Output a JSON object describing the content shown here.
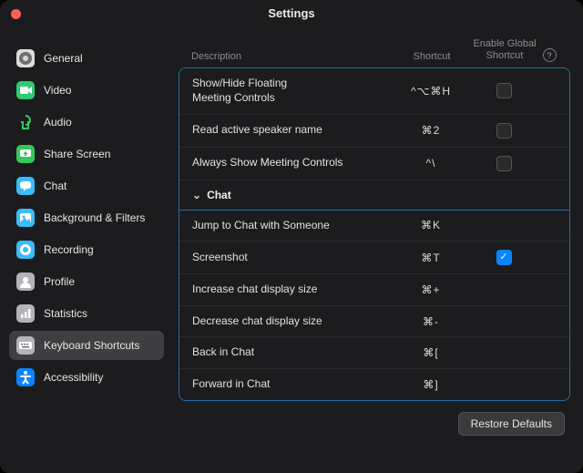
{
  "window": {
    "title": "Settings"
  },
  "sidebar": {
    "items": [
      {
        "id": "general",
        "label": "General",
        "color": "#dcdcdc",
        "icon": "<circle cx='10' cy='10' r='7' fill='#6e6e6e'/><circle cx='10' cy='10' r='3' fill='#d8d8d8'/>"
      },
      {
        "id": "video",
        "label": "Video",
        "color": "#2ecc71",
        "icon": "<rect x='4' y='6' width='9' height='8' rx='1.5' fill='#fff'/><path d='M13 9 L17 6 V14 L13 11 Z' fill='#fff'/>"
      },
      {
        "id": "audio",
        "label": "Audio",
        "color": "none",
        "icon": "<path d='M10 3 A5 5 0 0 1 10 13' fill='none' stroke='#34c759' stroke-width='2'/><path d='M5 10 h2 v7 h6 v-7 h2' fill='none' stroke='#34c759' stroke-width='2'/>"
      },
      {
        "id": "share",
        "label": "Share Screen",
        "color": "#34c759",
        "icon": "<rect x='4' y='5' width='12' height='8' rx='1.5' fill='#fff'/><path d='M10 7 L7 10 H9 V12 H11 V10 H13 Z' fill='#34c759'/>"
      },
      {
        "id": "chat",
        "label": "Chat",
        "color": "#38bdf8",
        "icon": "<rect x='4' y='5' width='12' height='8' rx='3' fill='#fff'/><path d='M8 13 L8 16 L11 13 Z' fill='#fff'/>"
      },
      {
        "id": "bg",
        "label": "Background & Filters",
        "color": "#38bdf8",
        "icon": "<rect x='4' y='5' width='12' height='10' rx='2' fill='#fff'/><circle cx='8' cy='9' r='1.5' fill='#38bdf8'/><path d='M5 14 L9 10 L12 13 L15 11 V15 H5 Z' fill='#38bdf8'/>"
      },
      {
        "id": "rec",
        "label": "Recording",
        "color": "#38bdf8",
        "icon": "<circle cx='10' cy='10' r='6' fill='#fff'/><circle cx='10' cy='10' r='3' fill='#38bdf8'/>"
      },
      {
        "id": "profile",
        "label": "Profile",
        "color": "#b4b4b8",
        "icon": "<circle cx='10' cy='8' r='3' fill='#fff'/><path d='M4 17 a6 6 0 0 1 12 0 Z' fill='#fff'/>"
      },
      {
        "id": "stats",
        "label": "Statistics",
        "color": "#b4b4b8",
        "icon": "<rect x='5' y='11' width='2.5' height='4' fill='#fff'/><rect x='9' y='8' width='2.5' height='7' fill='#fff'/><rect x='13' y='5' width='2.5' height='10' fill='#fff'/>"
      },
      {
        "id": "kbd",
        "label": "Keyboard Shortcuts",
        "color": "#b4b4b8",
        "icon": "<rect x='3' y='6' width='14' height='8' rx='1.5' fill='#fff'/><rect x='5' y='8' width='2' height='1.5' fill='#6e6e6e'/><rect x='8' y='8' width='2' height='1.5' fill='#6e6e6e'/><rect x='11' y='8' width='2' height='1.5' fill='#6e6e6e'/><rect x='6' y='11' width='8' height='1.5' fill='#6e6e6e'/>"
      },
      {
        "id": "a11y",
        "label": "Accessibility",
        "color": "#0a84ff",
        "icon": "<circle cx='10' cy='5' r='2' fill='#fff'/><rect x='4' y='8' width='12' height='2' rx='1' fill='#fff'/><path d='M10 9 V13 L7 17 M10 13 L13 17' stroke='#fff' stroke-width='2' fill='none'/>"
      }
    ],
    "active": "kbd"
  },
  "columns": {
    "desc": "Description",
    "shortcut": "Shortcut",
    "global": "Enable Global Shortcut"
  },
  "rows": [
    {
      "type": "item",
      "desc": "Show/Hide Floating\nMeeting Controls",
      "shortcut": "^⌥⌘H",
      "global": "off"
    },
    {
      "type": "item",
      "desc": "Read active speaker name",
      "shortcut": "⌘2",
      "global": "off"
    },
    {
      "type": "item",
      "desc": "Always Show Meeting Controls",
      "shortcut": "^\\",
      "global": "off"
    },
    {
      "type": "section",
      "desc": "Chat"
    },
    {
      "type": "item",
      "desc": "Jump to Chat with Someone",
      "shortcut": "⌘K",
      "global": "none"
    },
    {
      "type": "item",
      "desc": "Screenshot",
      "shortcut": "⌘T",
      "global": "on"
    },
    {
      "type": "item",
      "desc": "Increase chat display size",
      "shortcut": "⌘+",
      "global": "none"
    },
    {
      "type": "item",
      "desc": "Decrease chat display size",
      "shortcut": "⌘-",
      "global": "none"
    },
    {
      "type": "item",
      "desc": "Back in Chat",
      "shortcut": "⌘[",
      "global": "none"
    },
    {
      "type": "item",
      "desc": "Forward in Chat",
      "shortcut": "⌘]",
      "global": "none"
    }
  ],
  "footer": {
    "restore": "Restore Defaults"
  }
}
